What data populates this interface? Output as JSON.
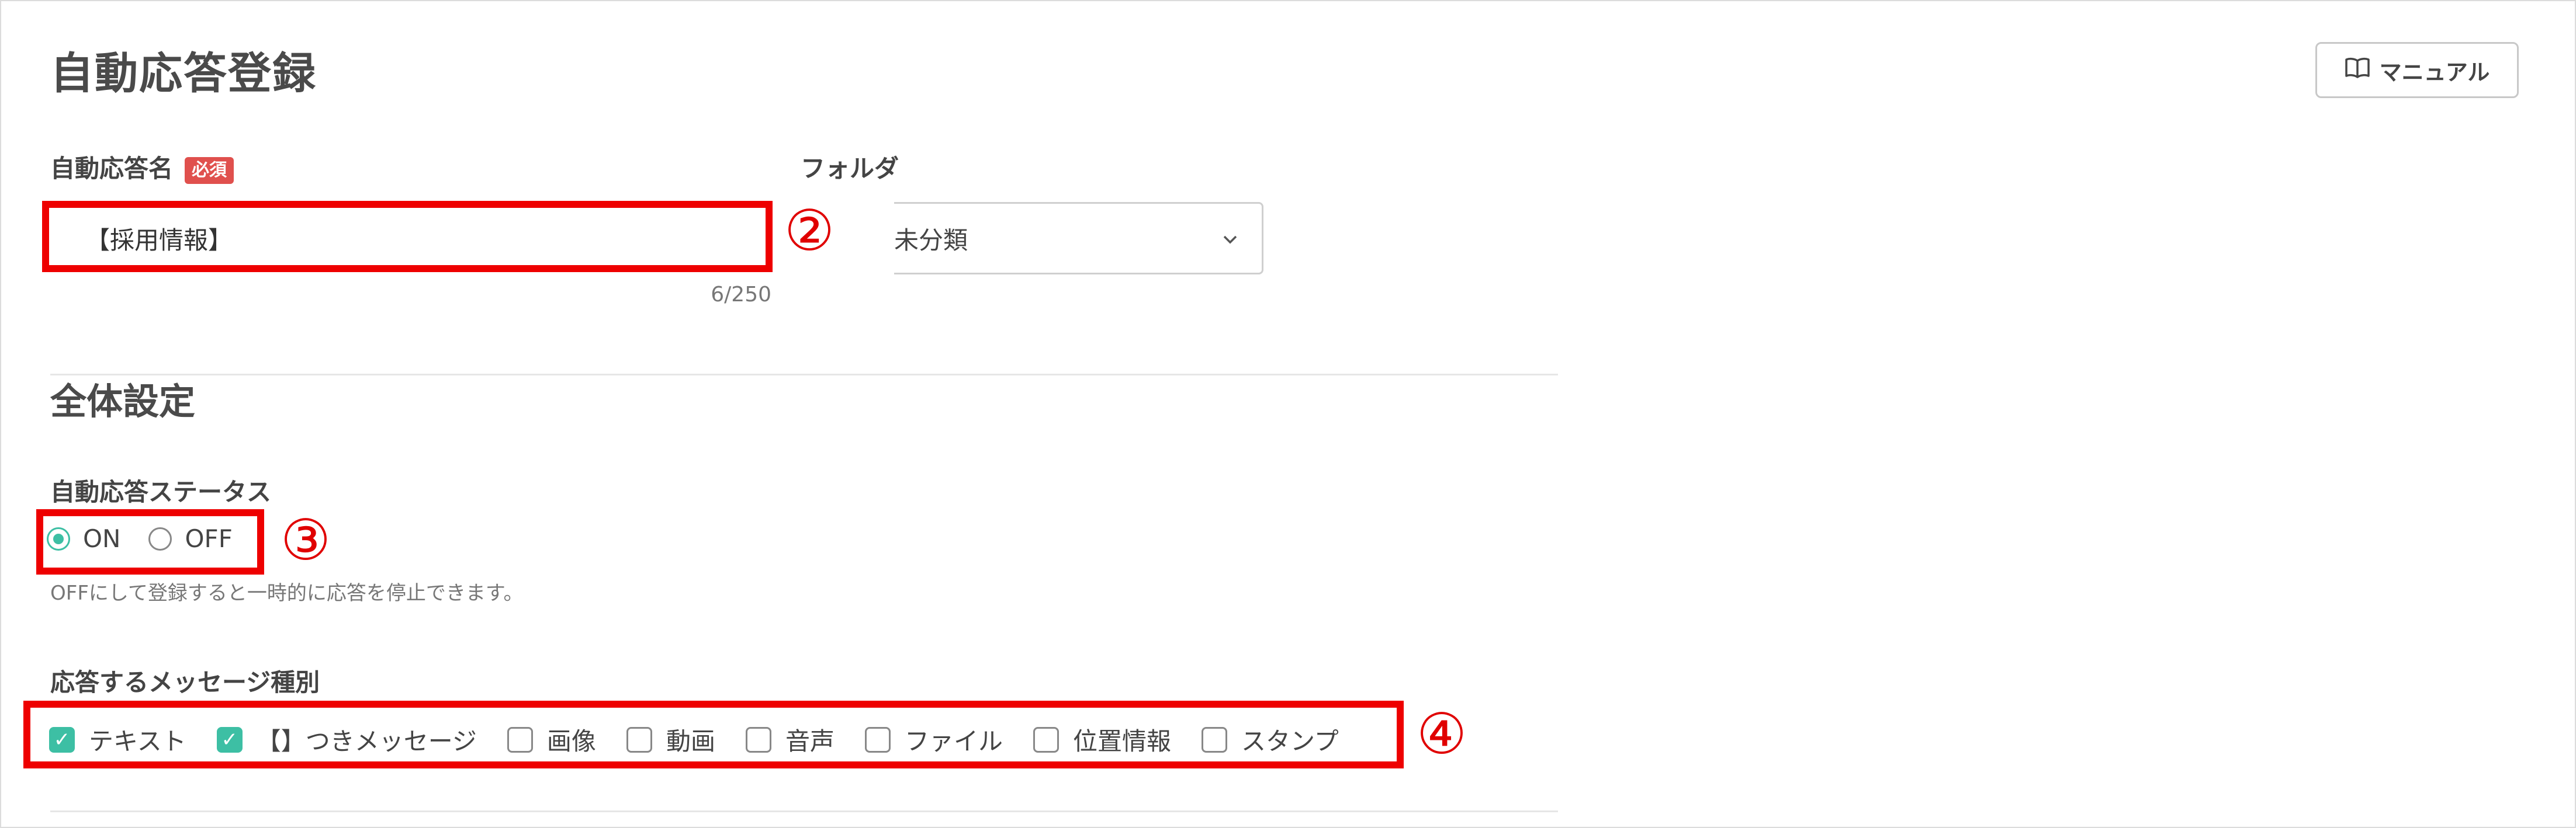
{
  "page": {
    "title": "自動応答登録",
    "manual_label": "マニュアル"
  },
  "form": {
    "name_label": "自動応答名",
    "required_badge": "必須",
    "name_value": "【採用情報】",
    "name_counter": "6/250",
    "folder_label": "フォルダ",
    "folder_value": "未分類"
  },
  "overall": {
    "section_title": "全体設定",
    "status_label": "自動応答ステータス",
    "status_options": [
      {
        "label": "ON",
        "selected": true
      },
      {
        "label": "OFF",
        "selected": false
      }
    ],
    "status_hint": "OFFにして登録すると一時的に応答を停止できます。",
    "message_types_label": "応答するメッセージ種別",
    "message_types": [
      {
        "label": "テキスト",
        "checked": true
      },
      {
        "label": "【】つきメッセージ",
        "checked": true
      },
      {
        "label": "画像",
        "checked": false
      },
      {
        "label": "動画",
        "checked": false
      },
      {
        "label": "音声",
        "checked": false
      },
      {
        "label": "ファイル",
        "checked": false
      },
      {
        "label": "位置情報",
        "checked": false
      },
      {
        "label": "スタンプ",
        "checked": false
      }
    ]
  },
  "annotations": {
    "marker_2": "②",
    "marker_3": "③",
    "marker_4": "④"
  },
  "icons": {
    "manual": "book-icon",
    "folder_dropdown": "chevron-down-icon",
    "checkbox_checked": "check-icon"
  },
  "colors": {
    "accent": "#3dbfa4",
    "badge": "#e0504d",
    "annotation": "#ee0000"
  }
}
